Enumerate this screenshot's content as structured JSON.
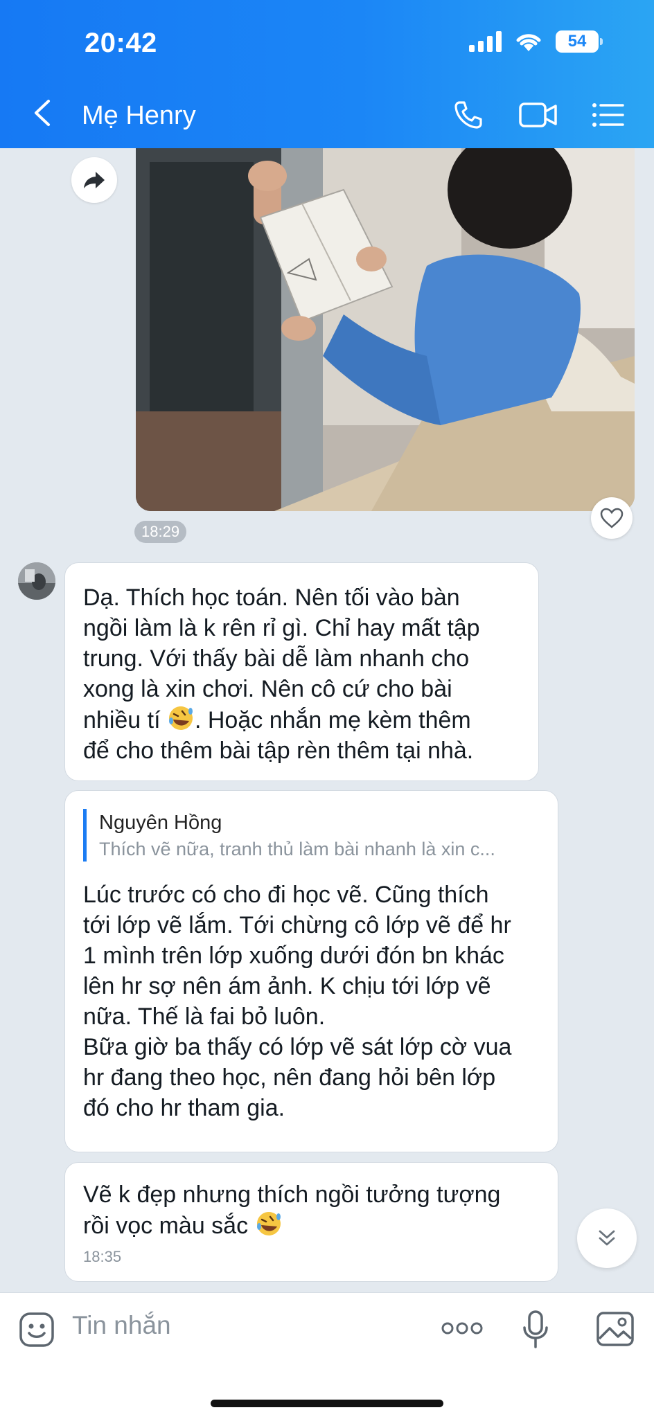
{
  "status_bar": {
    "time": "20:42",
    "battery": "54"
  },
  "header": {
    "title": "Mẹ Henry"
  },
  "messages": {
    "photo_time": "18:29",
    "msg1": "Dạ. Thích học toán. Nên tối vào bàn\nngồi làm là k rên rỉ gì. Chỉ hay mất tập\ntrung. Với thấy bài dễ làm nhanh cho\nxong là xin chơi. Nên cô cứ cho bài",
    "msg1_line5_a": "nhiều tí ",
    "msg1_line5_b": ". Hoặc nhắn mẹ kèm thêm",
    "msg1_line6": "để cho thêm bài tập rèn thêm tại nhà.",
    "msg2_quote_name": "Nguyên Hồng",
    "msg2_quote_text": "Thích vẽ nữa, tranh thủ làm bài nhanh là xin c...",
    "msg2": "Lúc trước có cho đi học vẽ. Cũng thích\ntới lớp vẽ lắm. Tới chừng cô lớp vẽ để hr\n1 mình trên lớp xuống dưới đón bn khác\nlên hr sợ nên ám ảnh. K chịu tới lớp vẽ\nnữa. Thế là fai bỏ luôn.\nBữa giờ ba thấy có lớp vẽ sát lớp cờ vua\nhr đang theo học, nên đang hỏi bên lớp\nđó cho hr tham gia.",
    "msg3_line1": "Vẽ k đẹp nhưng thích ngồi tưởng tượng",
    "msg3_line2": "rồi vọc màu sắc ",
    "msg3_time": "18:35"
  },
  "input": {
    "placeholder": "Tin nhắn"
  },
  "icons": {
    "back": "chevron-left-icon",
    "call": "phone-icon",
    "video": "video-camera-icon",
    "menu": "list-menu-icon",
    "share": "forward-arrow-icon",
    "react": "heart-icon",
    "scroll": "double-chevron-down-icon",
    "sticker": "smiley-icon",
    "more": "more-dots-icon",
    "voice": "microphone-icon",
    "gallery": "image-icon",
    "emoji": "rofl-emoji-icon"
  },
  "colors": {
    "accent": "#1b86f6",
    "chat_bg": "#e3e9ef",
    "quote_bar": "#1b7cf3"
  }
}
